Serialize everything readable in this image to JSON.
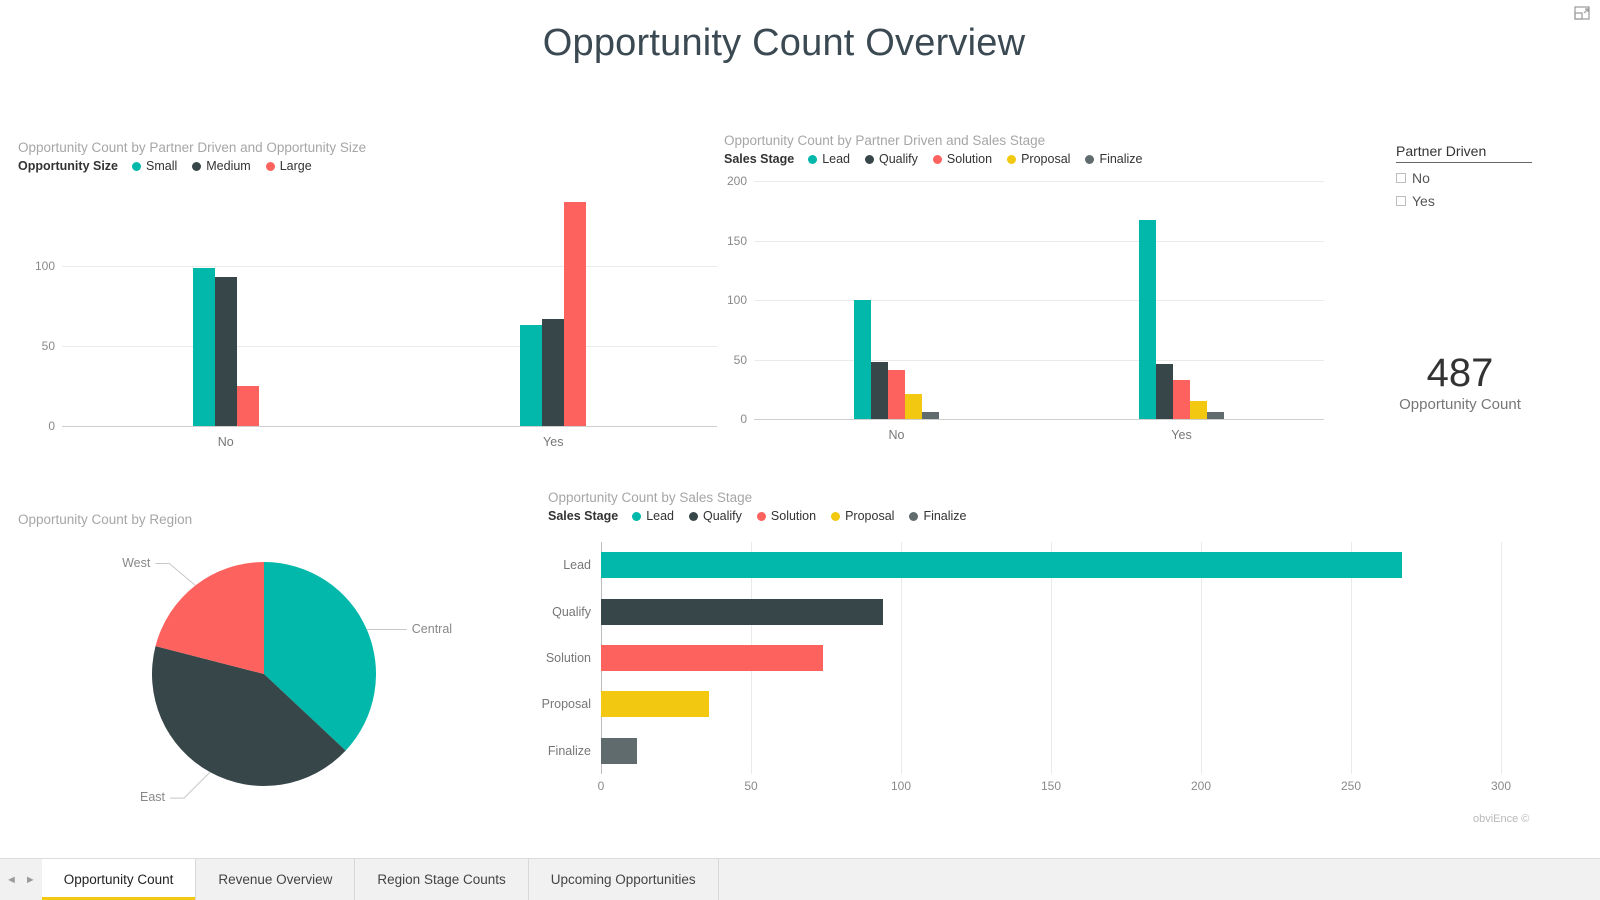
{
  "window": {
    "focus_icon": "focus-mode-icon"
  },
  "report": {
    "title": "Opportunity Count Overview",
    "watermark": "obviEnce ©"
  },
  "colors": {
    "teal": "#01B8AA",
    "dark": "#374649",
    "red": "#FD625E",
    "yellow": "#F2C811",
    "gray": "#5F6B6D",
    "accent_tab": "#F2C811"
  },
  "visual_partner_size": {
    "title": "Opportunity Count by Partner Driven and Opportunity Size",
    "legend_title": "Opportunity Size"
  },
  "visual_partner_stage": {
    "title": "Opportunity Count by Partner Driven and Sales Stage",
    "legend_title": "Sales Stage"
  },
  "visual_region": {
    "title": "Opportunity Count by Region"
  },
  "visual_stage": {
    "title": "Opportunity Count by Sales Stage",
    "legend_title": "Sales Stage"
  },
  "slicer": {
    "title": "Partner Driven",
    "items": [
      {
        "label": "No",
        "checked": false
      },
      {
        "label": "Yes",
        "checked": false
      }
    ]
  },
  "card": {
    "value": "487",
    "label": "Opportunity Count"
  },
  "tabs": [
    {
      "label": "Opportunity Count",
      "active": true
    },
    {
      "label": "Revenue Overview",
      "active": false
    },
    {
      "label": "Region Stage Counts",
      "active": false
    },
    {
      "label": "Upcoming Opportunities",
      "active": false
    }
  ],
  "nav": {
    "prev": "◄",
    "next": "►"
  },
  "chart_data": [
    {
      "id": "partner_size",
      "type": "bar",
      "title": "Opportunity Count by Partner Driven and Opportunity Size",
      "xlabel": "",
      "ylabel": "",
      "categories": [
        "No",
        "Yes"
      ],
      "yticks": [
        0,
        50,
        100
      ],
      "ylim": [
        0,
        150
      ],
      "grid": true,
      "legend": "top",
      "legend_title": "Opportunity Size",
      "series": [
        {
          "name": "Small",
          "color": "#01B8AA",
          "values": [
            99,
            63
          ]
        },
        {
          "name": "Medium",
          "color": "#374649",
          "values": [
            93,
            67
          ]
        },
        {
          "name": "Large",
          "color": "#FD625E",
          "values": [
            25,
            140
          ]
        }
      ]
    },
    {
      "id": "partner_stage",
      "type": "bar",
      "title": "Opportunity Count by Partner Driven and Sales Stage",
      "xlabel": "",
      "ylabel": "",
      "categories": [
        "No",
        "Yes"
      ],
      "yticks": [
        0,
        50,
        100,
        150,
        200
      ],
      "ylim": [
        0,
        200
      ],
      "grid": true,
      "legend": "top",
      "legend_title": "Sales Stage",
      "series": [
        {
          "name": "Lead",
          "color": "#01B8AA",
          "values": [
            100,
            167
          ]
        },
        {
          "name": "Qualify",
          "color": "#374649",
          "values": [
            48,
            46
          ]
        },
        {
          "name": "Solution",
          "color": "#FD625E",
          "values": [
            41,
            33
          ]
        },
        {
          "name": "Proposal",
          "color": "#F2C811",
          "values": [
            21,
            15
          ]
        },
        {
          "name": "Finalize",
          "color": "#5F6B6D",
          "values": [
            6,
            6
          ]
        }
      ]
    },
    {
      "id": "region",
      "type": "pie",
      "title": "Opportunity Count by Region",
      "labels": [
        "Central",
        "East",
        "West"
      ],
      "values": [
        37,
        42,
        21
      ],
      "colors": [
        "#01B8AA",
        "#374649",
        "#FD625E"
      ]
    },
    {
      "id": "sales_stage",
      "type": "bar",
      "orientation": "horizontal",
      "title": "Opportunity Count by Sales Stage",
      "legend_title": "Sales Stage",
      "categories": [
        "Lead",
        "Qualify",
        "Solution",
        "Proposal",
        "Finalize"
      ],
      "values": [
        267,
        94,
        74,
        36,
        12
      ],
      "colors": [
        "#01B8AA",
        "#374649",
        "#FD625E",
        "#F2C811",
        "#5F6B6D"
      ],
      "xticks": [
        0,
        50,
        100,
        150,
        200,
        250,
        300
      ],
      "xlim": [
        0,
        300
      ],
      "xlabel": "",
      "ylabel": "",
      "grid": true,
      "legend": "top"
    }
  ]
}
